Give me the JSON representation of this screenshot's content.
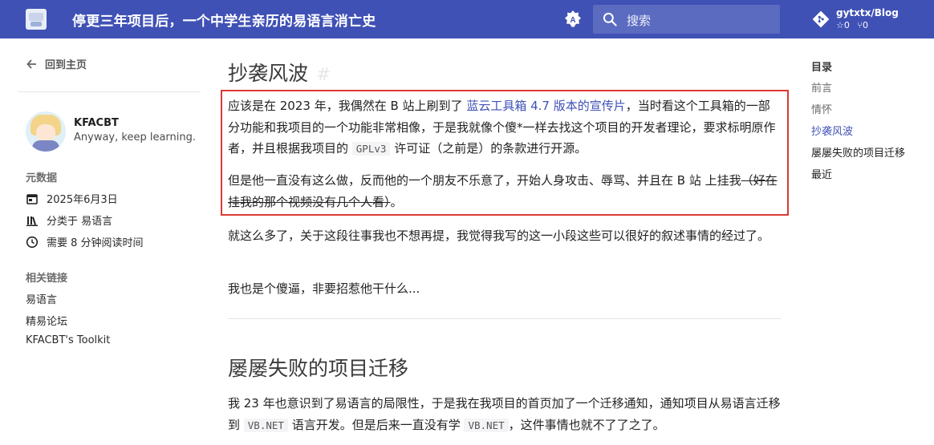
{
  "header": {
    "title": "停更三年项目后，一个中学生亲历的易语言消亡史",
    "search_placeholder": "搜索",
    "repo_name": "gytxtx/Blog",
    "repo_stars": "0",
    "repo_forks": "0",
    "color": "#4051b5"
  },
  "sidebar": {
    "back_label": "回到主页",
    "author": {
      "name": "KFACBT",
      "bio": "Anyway, keep learning."
    },
    "metadata_heading": "元数据",
    "metadata": {
      "date": "2025年6月3日",
      "category": "分类于 易语言",
      "reading_time": "需要 8 分钟阅读时间"
    },
    "links_heading": "相关链接",
    "links": [
      "易语言",
      "精易论坛",
      "KFACBT's Toolkit"
    ]
  },
  "main": {
    "section1": {
      "title": "抄袭风波",
      "anchor": "#",
      "p1_a": "应该是在 2023 年，我偶然在 B 站上刷到了 ",
      "p1_link": "蓝云工具箱 4.7 版本的宣传片",
      "p1_b": "，当时看这个工具箱的一部分功能和我项目的一个功能非常相像，于是我就像个傻*一样去找这个项目的开发者理论，要求标明原作者，并且根据我项目的 ",
      "p1_code": "GPLv3",
      "p1_c": " 许可证（之前是）的条款进行开源。",
      "p2_a": "但是他一直没有这么做，反而他的一个朋友不乐意了，开始人身攻击、辱骂、并且在 B 站 上挂我",
      "p2_strike": "（好在挂我的那个视频没有几个人看）",
      "p2_b": "。",
      "p3": "就这么多了，关于这段往事我也不想再提，我觉得我写的这一小段这些可以很好的叙述事情的经过了。",
      "p4": "我也是个傻逼，非要招惹他干什么..."
    },
    "section2": {
      "title": "屡屡失败的项目迁移",
      "p1_a": "我 23 年也意识到了易语言的局限性，于是我在我项目的首页加了一个迁移通知，通知项目从易语言迁移到 ",
      "p1_code1": "VB.NET",
      "p1_b": " 语言开发。但是后来一直没有学 ",
      "p1_code2": "VB.NET",
      "p1_c": "，这件事情也就不了了之了。"
    }
  },
  "toc": {
    "title": "目录",
    "items": [
      "前言",
      "情怀",
      "抄袭风波",
      "屡屡失败的项目迁移",
      "最近"
    ],
    "active_index": 2,
    "active_color": "#4051b5"
  },
  "highlight_color": "#d93a35"
}
